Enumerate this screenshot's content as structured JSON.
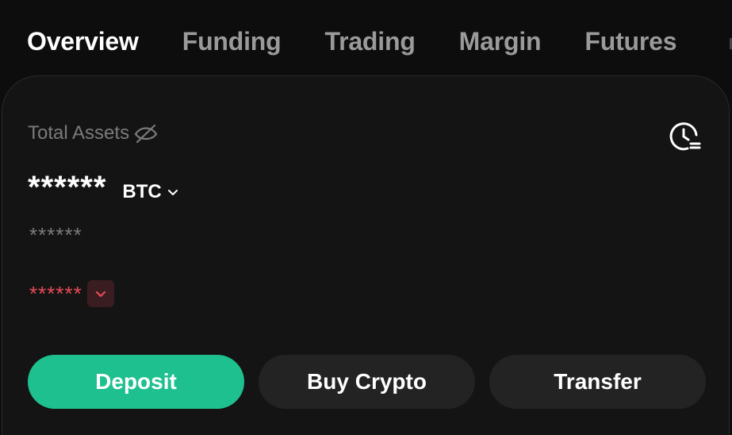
{
  "tabs": [
    {
      "label": "Overview",
      "active": true
    },
    {
      "label": "Funding",
      "active": false
    },
    {
      "label": "Trading",
      "active": false
    },
    {
      "label": "Margin",
      "active": false
    },
    {
      "label": "Futures",
      "active": false
    }
  ],
  "overview": {
    "total_assets_label": "Total Assets",
    "balance_masked": "******",
    "currency": "BTC",
    "sub_balance_masked": "******",
    "pnl_masked": "******"
  },
  "actions": {
    "deposit_label": "Deposit",
    "buy_crypto_label": "Buy Crypto",
    "transfer_label": "Transfer"
  },
  "icons": {
    "visibility_toggle": "eye-off-icon",
    "history": "clock-history-icon",
    "currency_dropdown": "chevron-down-icon",
    "pnl_toggle": "chevron-down-icon"
  },
  "colors": {
    "accent": "#1fc08f",
    "loss": "#e84b57",
    "background": "#0d0d0d",
    "card": "#141414",
    "secondary_button": "#232323",
    "muted_text": "#7b7b7b",
    "inactive_tab": "#9a9a9a"
  }
}
